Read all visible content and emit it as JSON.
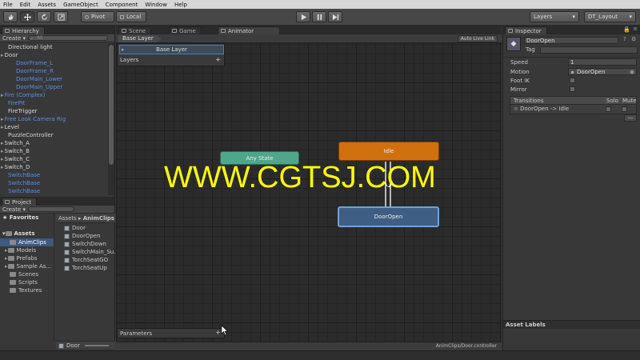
{
  "menu": [
    "File",
    "Edit",
    "Assets",
    "GameObject",
    "Component",
    "Window",
    "Help"
  ],
  "toolbar": {
    "pivot": "Pivot",
    "local": "Local",
    "layers": "Layers",
    "layout": "DT_Layout"
  },
  "hierarchy": {
    "tab": "Hierarchy",
    "create": "Create",
    "search_placeholder": "All",
    "items": [
      {
        "label": "Directional light",
        "color": "white",
        "indent": 0,
        "arrow": false
      },
      {
        "label": "Door",
        "color": "white",
        "indent": 0,
        "arrow": true
      },
      {
        "label": "DoorFrame_L",
        "color": "blue",
        "indent": 1,
        "arrow": false
      },
      {
        "label": "DoorFrame_R",
        "color": "blue",
        "indent": 1,
        "arrow": false
      },
      {
        "label": "DoorMain_Lower",
        "color": "blue",
        "indent": 1,
        "arrow": false
      },
      {
        "label": "DoorMain_Upper",
        "color": "blue",
        "indent": 1,
        "arrow": false
      },
      {
        "label": "Fire (Complex)",
        "color": "blue",
        "indent": 0,
        "arrow": true
      },
      {
        "label": "FirePit",
        "color": "blue",
        "indent": 0,
        "arrow": false
      },
      {
        "label": "FireTrigger",
        "color": "white",
        "indent": 0,
        "arrow": false
      },
      {
        "label": "Free Look Camera Rig",
        "color": "blue",
        "indent": 0,
        "arrow": true
      },
      {
        "label": "Level",
        "color": "white",
        "indent": 0,
        "arrow": true
      },
      {
        "label": "PuzzleController",
        "color": "white",
        "indent": 0,
        "arrow": false
      },
      {
        "label": "Switch_A",
        "color": "white",
        "indent": 0,
        "arrow": true
      },
      {
        "label": "Switch_B",
        "color": "white",
        "indent": 0,
        "arrow": true
      },
      {
        "label": "Switch_C",
        "color": "white",
        "indent": 0,
        "arrow": true
      },
      {
        "label": "Switch_D",
        "color": "white",
        "indent": 0,
        "arrow": true
      },
      {
        "label": "SwitchBase",
        "color": "blue",
        "indent": 0,
        "arrow": false
      },
      {
        "label": "SwitchBase",
        "color": "blue",
        "indent": 0,
        "arrow": false
      },
      {
        "label": "SwitchBase",
        "color": "blue",
        "indent": 0,
        "arrow": false
      }
    ]
  },
  "project": {
    "tab": "Project",
    "create": "Create",
    "favorites": "Favorites",
    "assets": "Assets",
    "folders": [
      "AnimClips",
      "Models",
      "Prefabs",
      "Sample As...",
      "Scenes",
      "Scripts",
      "Textures"
    ],
    "breadcrumb": [
      "Assets",
      "AnimClips"
    ],
    "files": [
      "Door",
      "DoorOpen",
      "SwitchDown",
      "SwitchMain_Su...",
      "TorchSeatGO",
      "TorchSeatUp"
    ],
    "footer_item": "Door"
  },
  "center_tabs": [
    "Scene",
    "Game",
    "Animator"
  ],
  "animator": {
    "breadcrumb": "Base Layer",
    "auto_live_link": "Auto Live Link",
    "layers_label": "Layers",
    "base_layer": "Base Layer",
    "parameters_label": "Parameters",
    "status_path": "AnimClips/Door.controller",
    "nodes": {
      "any_state": "Any State",
      "idle": "Idle",
      "door_open": "DoorOpen"
    }
  },
  "watermark": "WWW.CGTSJ.COM",
  "inspector": {
    "tab": "Inspector",
    "name": "DoorOpen",
    "tag_label": "Tag",
    "speed_label": "Speed",
    "speed_value": "1",
    "motion_label": "Motion",
    "motion_value": "DoorOpen",
    "footik_label": "Foot IK",
    "mirror_label": "Mirror",
    "transitions_label": "Transitions",
    "solo_label": "Solo",
    "mute_label": "Mute",
    "transition_item": "DoorOpen -> Idle",
    "minus": "—",
    "asset_labels": "Asset Labels"
  },
  "colors": {
    "any_state": "#4ea68b",
    "idle": "#d0700e",
    "door_open": "#3f5e83",
    "watermark": "#ffff00"
  }
}
